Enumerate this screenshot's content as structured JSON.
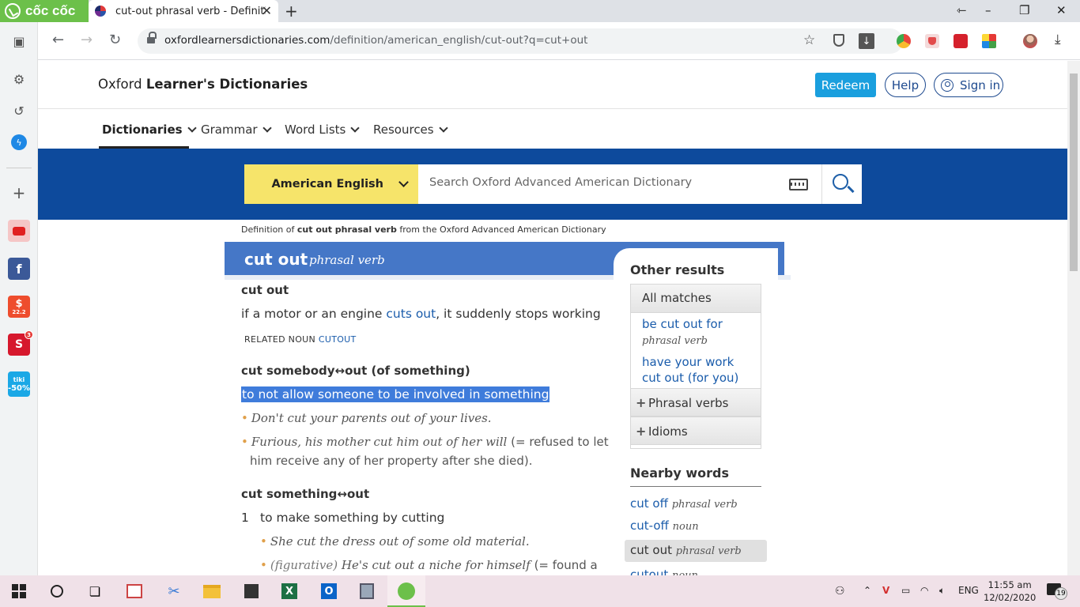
{
  "browser": {
    "logo_text": "cốc cốc",
    "tab_title": "cut-out phrasal verb - Definition",
    "tab_close": "✕",
    "new_tab": "+",
    "url_domain": "oxfordlearnersdictionaries.com",
    "url_path": "/definition/american_english/cut-out?q=cut+out",
    "window_controls": {
      "pin": "⇽",
      "minimize": "–",
      "restore": "❐",
      "close": "✕"
    }
  },
  "site": {
    "brand_light": "Oxford ",
    "brand_bold": "Learner's Dictionaries",
    "redeem": "Redeem",
    "help": "Help",
    "sign_in": "Sign in",
    "menu": [
      "Dictionaries",
      "Grammar",
      "Word Lists",
      "Resources"
    ],
    "dictionary_select": "American English",
    "search_placeholder": "Search Oxford Advanced American Dictionary"
  },
  "entry": {
    "def_of_prefix": "Definition of ",
    "def_of_word": "cut out phrasal verb",
    "def_of_suffix": " from the Oxford Advanced American Dictionary",
    "headword": "cut out",
    "pos": "phrasal verb",
    "sense1": {
      "head": "cut out",
      "def_a": "if a motor or an engine ",
      "def_link": "cuts out",
      "def_b": ", it suddenly stops working",
      "related_label": "RELATED NOUN ",
      "related_word": "CUTOUT"
    },
    "sense2": {
      "head": "cut somebody↔out (of something)",
      "def": "to not allow someone to be involved in something",
      "ex1": "Don't cut your parents out of your lives.",
      "ex2_italic": "Furious, his mother cut him out of her will",
      "ex2_plain": " (= refused to let",
      "ex2_line2": "him receive any of her property after she died)."
    },
    "sense3": {
      "head": "cut something↔out",
      "num": "1",
      "def": "to make something by cutting",
      "ex1": "She cut the dress out of some old material.",
      "ex2_label": "(figurative) ",
      "ex2_italic": "He's cut out a niche for himself",
      "ex2_plain": " (= found a"
    },
    "bullet": "•"
  },
  "panel": {
    "title": "Other results",
    "all_matches": "All matches",
    "matches": [
      {
        "word": "be cut out for",
        "pos": "phrasal verb"
      },
      {
        "word_line1": "have your work",
        "word_line2": "cut out (for you)"
      }
    ],
    "phrasal_verbs": "Phrasal verbs",
    "idioms": "Idioms",
    "plus": "+",
    "nearby_title": "Nearby words",
    "nearby": [
      {
        "word": "cut off",
        "pos": "phrasal verb"
      },
      {
        "word": "cut-off",
        "pos": "noun"
      },
      {
        "word": "cut out",
        "pos": "phrasal verb"
      },
      {
        "word": "cutout",
        "pos": "noun"
      }
    ]
  },
  "sidebar_badges": {
    "shopee": "22.2",
    "sendo_count": "3",
    "tiki": "tiki",
    "tiki_sale": "-50%"
  },
  "taskbar": {
    "language": "ENG",
    "time": "11:55 am",
    "date": "12/02/2020",
    "notification_count": "19"
  },
  "colors": {
    "brand_blue": "#0d4a9c",
    "headword_blue": "#4577c7",
    "link_blue": "#1a5cab",
    "dict_yellow": "#f6e46a",
    "redeem_blue": "#1a9fde",
    "coccoc_green": "#6cc04a"
  }
}
